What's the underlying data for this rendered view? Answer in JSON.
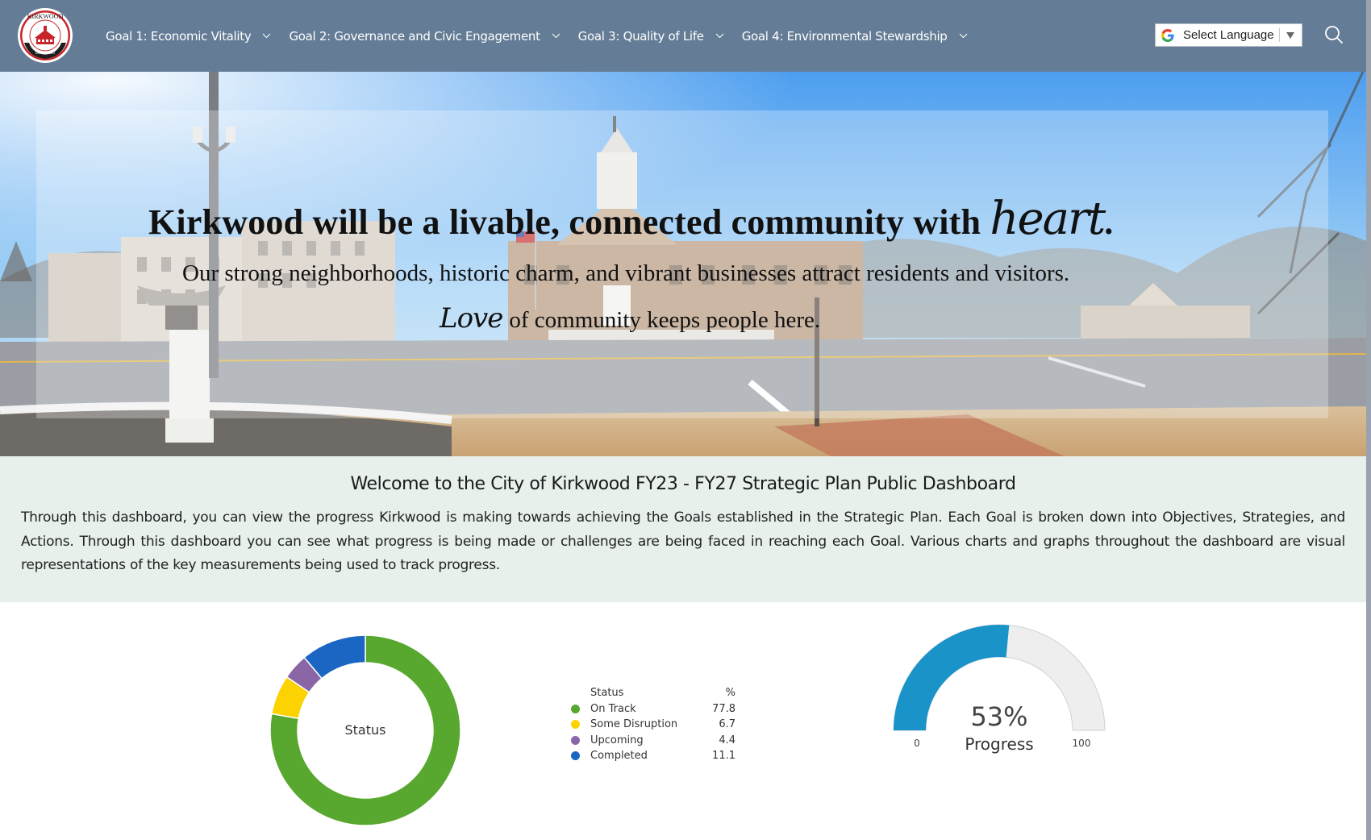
{
  "header": {
    "logo_alt": "Kirkwood Est. 1853 seal",
    "logo_text_top": "KIRKWOOD",
    "logo_text_bottom": "EST. • 1853",
    "nav": [
      {
        "label": "Goal 1: Economic Vitality",
        "icon": "chevron-down-icon"
      },
      {
        "label": "Goal 2: Governance and Civic Engagement",
        "icon": "chevron-down-icon"
      },
      {
        "label": "Goal 3: Quality of Life",
        "icon": "chevron-down-icon"
      },
      {
        "label": "Goal 4: Environmental Stewardship",
        "icon": "chevron-down-icon"
      }
    ],
    "language_select": {
      "label": "Select Language",
      "icon": "google-icon",
      "arrow": "▼"
    },
    "search_icon": "search-icon"
  },
  "hero": {
    "headline_prefix": "Kirkwood will be a livable, connected community with ",
    "headline_script": "heart",
    "headline_suffix": ".",
    "subline": "Our strong neighborhoods, historic charm, and vibrant businesses attract residents and visitors.",
    "subline2_script": "Love",
    "subline2_rest": "of community keeps people here."
  },
  "welcome": {
    "title": "Welcome to the City of Kirkwood FY23 - FY27 Strategic Plan Public Dashboard",
    "body": "Through this dashboard, you can view the progress Kirkwood is making towards achieving the Goals established in the Strategic Plan. Each Goal is broken down into Objectives, Strategies, and Actions. Through this dashboard you can see what progress is being made or challenges are being faced in reaching each Goal. Various charts and graphs throughout the dashboard are visual representations of the key measurements being used to track progress."
  },
  "chart_data": [
    {
      "type": "pie",
      "variant": "donut",
      "title": "Status",
      "center_label": "Status",
      "legend_header": {
        "name": "Status",
        "value": "%"
      },
      "legend_position": "right",
      "categories": [
        "On Track",
        "Some Disruption",
        "Upcoming",
        "Completed"
      ],
      "values": [
        77.8,
        6.7,
        4.4,
        11.1
      ],
      "value_labels": [
        "77.8",
        "6.7",
        "4.4",
        "11.1"
      ],
      "colors": [
        "#58a82f",
        "#fcd200",
        "#8a66a6",
        "#1b66c2"
      ]
    },
    {
      "type": "gauge",
      "title": "Progress",
      "value": 53,
      "value_label": "53%",
      "min": 0,
      "max": 100,
      "min_label": "0",
      "max_label": "100",
      "fill_color": "#1a93c9",
      "track_color": "#eeeeee"
    }
  ]
}
